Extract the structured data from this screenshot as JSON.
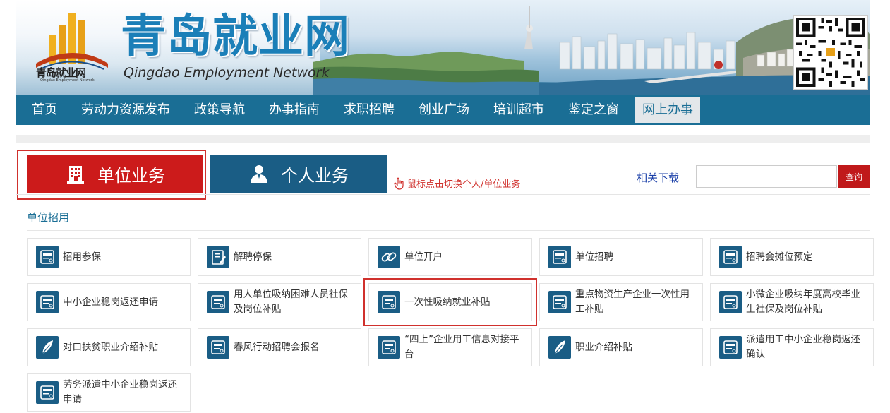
{
  "header": {
    "logo_cn": "青岛就业网",
    "logo_en": "Qingdao Employment Network",
    "site_title": "青岛就业网",
    "site_subtitle": "Qingdao Employment Network"
  },
  "nav": {
    "items": [
      "首页",
      "劳动力资源发布",
      "政策导航",
      "办事指南",
      "求职招聘",
      "创业广场",
      "培训超市",
      "鉴定之窗",
      "网上办事"
    ],
    "active_index": 8
  },
  "business": {
    "unit_label": "单位业务",
    "person_label": "个人业务",
    "hint": "鼠标点击切换个人/单位业务",
    "download_label": "相关下载",
    "search_placeholder": "",
    "search_value": "",
    "search_button": "查询",
    "selected": "unit"
  },
  "section": {
    "title": "单位招用"
  },
  "services": [
    {
      "label": "招用参保",
      "icon": "document-icon"
    },
    {
      "label": "解聘停保",
      "icon": "edit-document-icon"
    },
    {
      "label": "单位开户",
      "icon": "link-icon"
    },
    {
      "label": "单位招聘",
      "icon": "document-icon"
    },
    {
      "label": "招聘会摊位预定",
      "icon": "document-icon"
    },
    {
      "label": "中小企业稳岗返还申请",
      "icon": "document-icon"
    },
    {
      "label": "用人单位吸纳困难人员社保及岗位补贴",
      "icon": "document-icon"
    },
    {
      "label": "一次性吸纳就业补贴",
      "icon": "document-icon",
      "highlighted": true
    },
    {
      "label": "重点物资生产企业一次性用工补贴",
      "icon": "document-icon"
    },
    {
      "label": "小微企业吸纳年度高校毕业生社保及岗位补贴",
      "icon": "document-icon"
    },
    {
      "label": "对口扶贫职业介绍补贴",
      "icon": "feather-icon"
    },
    {
      "label": "春风行动招聘会报名",
      "icon": "document-icon"
    },
    {
      "label": "“四上”企业用工信息对接平台",
      "icon": "document-icon"
    },
    {
      "label": "职业介绍补贴",
      "icon": "feather-icon"
    },
    {
      "label": "派遣用工中小企业稳岗返还确认",
      "icon": "document-icon"
    },
    {
      "label": "劳务派遣中小企业稳岗返还申请",
      "icon": "document-icon"
    }
  ],
  "colors": {
    "nav_bg": "#1a6e95",
    "unit_tab": "#cc1b1b",
    "person_tab": "#1a5d85",
    "accent_red": "#d0312d",
    "icon_bg": "#1a5d85"
  }
}
